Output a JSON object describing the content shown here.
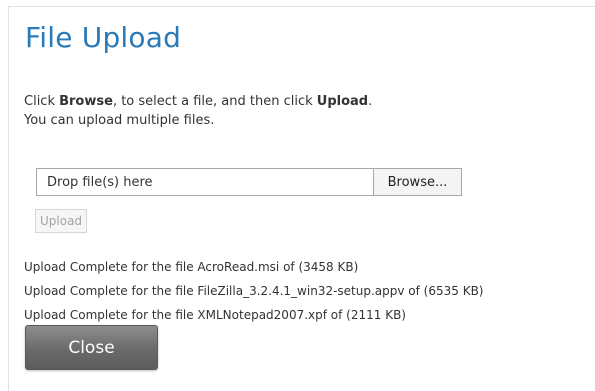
{
  "dialog": {
    "title": "File Upload",
    "instructions": {
      "line1_part1": "Click ",
      "line1_browse": "Browse",
      "line1_part2": ", to select a file, and then click ",
      "line1_upload": "Upload",
      "line1_part3": ".",
      "line2": "You can upload multiple files."
    },
    "drop_field": {
      "placeholder": "Drop file(s) here",
      "value": ""
    },
    "browse_label": "Browse...",
    "upload_label": "Upload",
    "upload_enabled": false,
    "log": [
      "Upload Complete for the file AcroRead.msi of (3458 KB)",
      "Upload Complete for the file FileZilla_3.2.4.1_win32-setup.appv of (6535 KB)",
      "Upload Complete for the file XMLNotepad2007.xpf of (2111 KB)"
    ],
    "close_label": "Close"
  },
  "colors": {
    "title": "#2a7ab8",
    "text": "#333333",
    "disabled_text": "#a2a2a2",
    "close_button": "#6a6a6a"
  }
}
